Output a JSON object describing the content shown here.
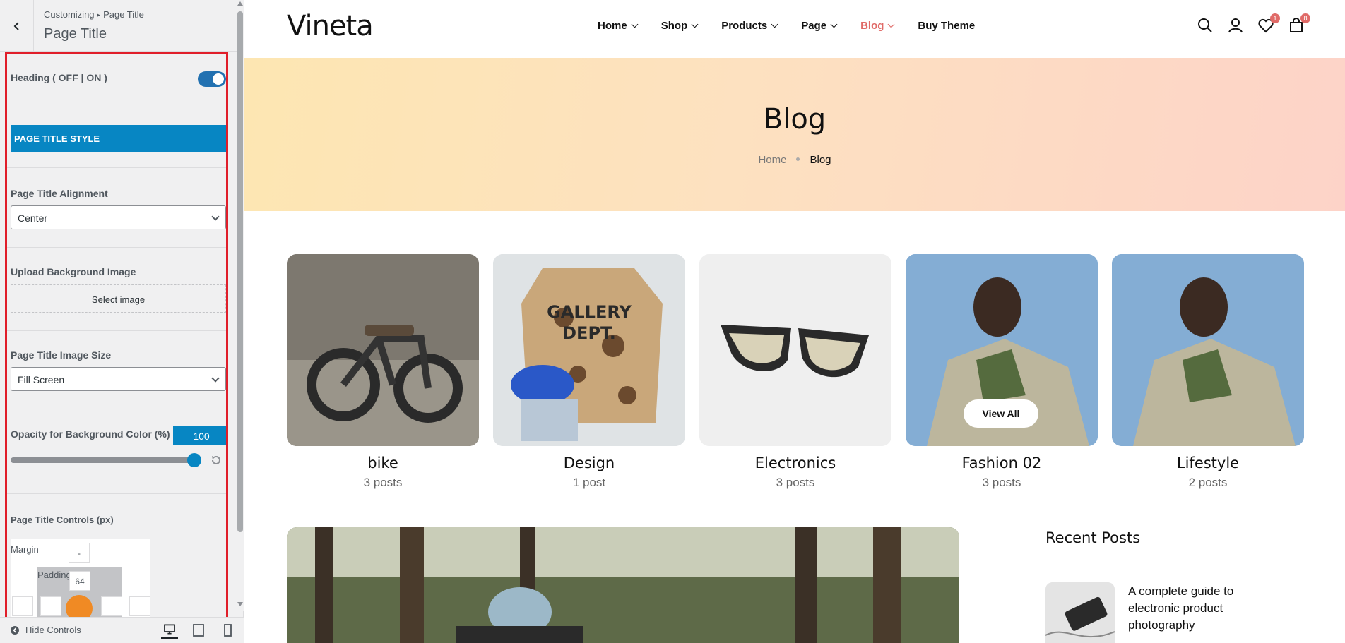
{
  "sidebar": {
    "breadcrumb_root": "Customizing",
    "breadcrumb_sep": "▸",
    "breadcrumb_current": "Page Title",
    "title": "Page Title",
    "heading_toggle_label": "Heading ( OFF | ON )",
    "heading_toggle_on": true,
    "section_title": "PAGE TITLE STYLE",
    "alignment_label": "Page Title Alignment",
    "alignment_value": "Center",
    "upload_label": "Upload Background Image",
    "upload_button": "Select image",
    "image_size_label": "Page Title Image Size",
    "image_size_value": "Fill Screen",
    "opacity_label": "Opacity for Background Color (%)",
    "opacity_value": "100",
    "opacity_level": 100,
    "controls_label": "Page Title Controls (px)",
    "margin_label": "Margin",
    "margin_top": "-",
    "padding_label": "Padding",
    "padding_top": "64",
    "hide_controls": "Hide Controls",
    "accent_color": "#0786c3",
    "highlight_color": "#e01e2a"
  },
  "site": {
    "logo": "Vineta",
    "nav": [
      {
        "label": "Home",
        "dropdown": true
      },
      {
        "label": "Shop",
        "dropdown": true
      },
      {
        "label": "Products",
        "dropdown": true
      },
      {
        "label": "Page",
        "dropdown": true
      },
      {
        "label": "Blog",
        "dropdown": true,
        "active": true
      },
      {
        "label": "Buy Theme",
        "dropdown": false
      }
    ],
    "wishlist_count": "1",
    "cart_count": "8",
    "hero_title": "Blog",
    "hero_crumb_home": "Home",
    "hero_crumb_current": "Blog",
    "categories": [
      {
        "name": "bike",
        "count": "3 posts"
      },
      {
        "name": "Design",
        "count": "1 post"
      },
      {
        "name": "Electronics",
        "count": "3 posts"
      },
      {
        "name": "Fashion 02",
        "count": "3 posts"
      },
      {
        "name": "Lifestyle",
        "count": "2 posts"
      }
    ],
    "view_all": "View All",
    "recent_posts_title": "Recent Posts",
    "recent_post_title": "A complete guide to electronic product photography",
    "accent_color": "#e06b68"
  }
}
